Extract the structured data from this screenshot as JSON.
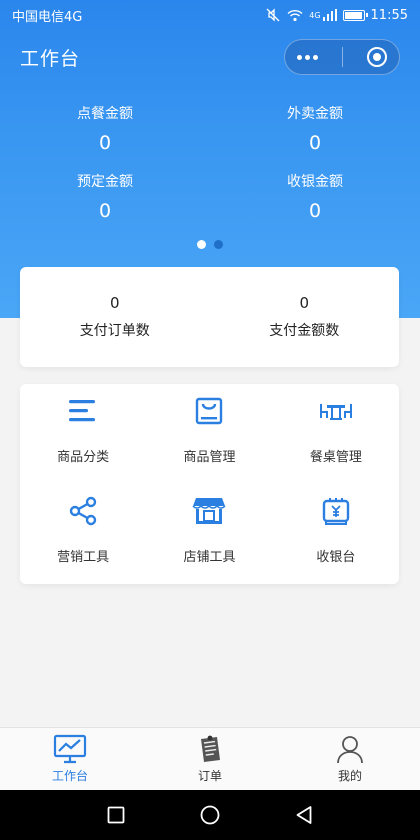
{
  "status_bar": {
    "carrier": "中国电信4G",
    "network_label": "4G",
    "time": "11:55",
    "battery_level": 0.85
  },
  "navbar": {
    "title": "工作台"
  },
  "summary": {
    "items": [
      {
        "label": "点餐金额",
        "value": "0"
      },
      {
        "label": "外卖金额",
        "value": "0"
      },
      {
        "label": "预定金额",
        "value": "0"
      },
      {
        "label": "收银金额",
        "value": "0"
      }
    ],
    "pager": {
      "pages": 2,
      "active": 1
    }
  },
  "payment": {
    "items": [
      {
        "value": "0",
        "label": "支付订单数"
      },
      {
        "value": "0",
        "label": "支付金额数"
      }
    ]
  },
  "tools": {
    "items": [
      {
        "label": "商品分类",
        "icon": "list-lines-icon"
      },
      {
        "label": "商品管理",
        "icon": "shopping-bag-icon"
      },
      {
        "label": "餐桌管理",
        "icon": "dining-table-icon"
      },
      {
        "label": "营销工具",
        "icon": "share-icon"
      },
      {
        "label": "店铺工具",
        "icon": "storefront-icon"
      },
      {
        "label": "收银台",
        "icon": "cash-register-icon"
      }
    ]
  },
  "tabbar": {
    "items": [
      {
        "label": "工作台",
        "icon": "dashboard-monitor-icon",
        "active": true
      },
      {
        "label": "订单",
        "icon": "order-list-icon",
        "active": false
      },
      {
        "label": "我的",
        "icon": "user-icon",
        "active": false
      }
    ]
  },
  "colors": {
    "brand_blue": "#2a86ec",
    "icon_blue": "#2a7fe0",
    "tab_active": "#2a7fe0",
    "background": "#f3f3f3"
  }
}
